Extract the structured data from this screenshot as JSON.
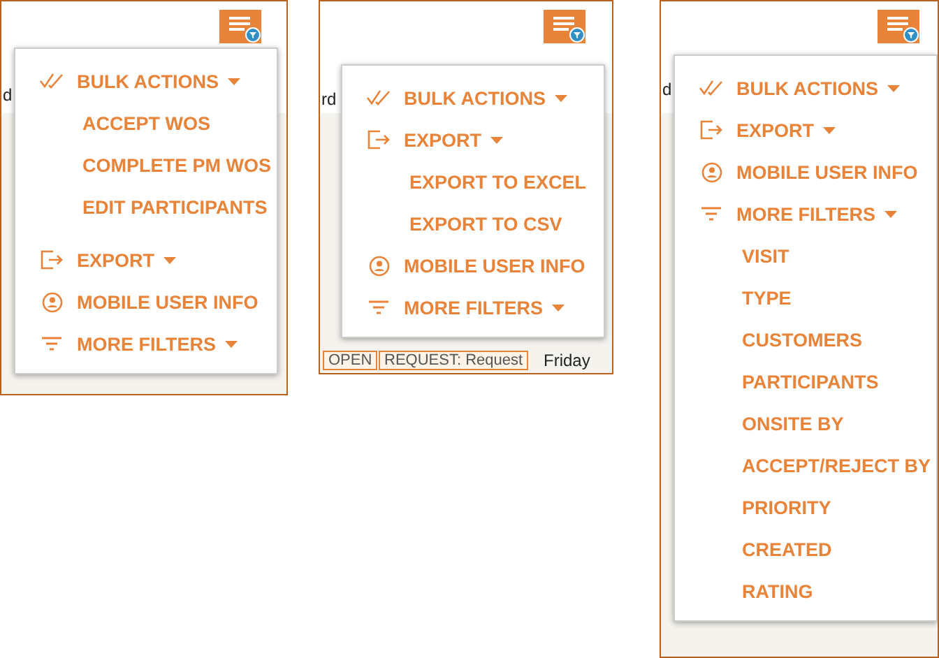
{
  "panels": [
    {
      "fragments": [
        {
          "text": "d",
          "kind": "label"
        }
      ],
      "menu": {
        "items": [
          {
            "kind": "bulk",
            "label": "BULK ACTIONS",
            "children": [
              "ACCEPT WOS",
              "COMPLETE PM WOS",
              "EDIT PARTICIPANTS"
            ]
          },
          {
            "kind": "export",
            "label": "EXPORT"
          },
          {
            "kind": "user",
            "label": "MOBILE USER INFO"
          },
          {
            "kind": "filter",
            "label": "MORE FILTERS"
          }
        ]
      }
    },
    {
      "fragments": [
        {
          "text": "rd",
          "kind": "label"
        },
        {
          "text": "OPEN",
          "kind": "cell"
        },
        {
          "text": "REQUEST: Request",
          "kind": "cell"
        },
        {
          "text": "Friday",
          "kind": "plain"
        }
      ],
      "menu": {
        "items": [
          {
            "kind": "bulk",
            "label": "BULK ACTIONS"
          },
          {
            "kind": "export",
            "label": "EXPORT",
            "children": [
              "EXPORT TO EXCEL",
              "EXPORT TO CSV"
            ]
          },
          {
            "kind": "user",
            "label": "MOBILE USER INFO"
          },
          {
            "kind": "filter",
            "label": "MORE FILTERS"
          }
        ]
      }
    },
    {
      "fragments": [
        {
          "text": "d",
          "kind": "label"
        }
      ],
      "menu": {
        "items": [
          {
            "kind": "bulk",
            "label": "BULK ACTIONS"
          },
          {
            "kind": "export",
            "label": "EXPORT"
          },
          {
            "kind": "user",
            "label": "MOBILE USER INFO"
          },
          {
            "kind": "filter",
            "label": "MORE FILTERS",
            "children": [
              "VISIT",
              "TYPE",
              "CUSTOMERS",
              "PARTICIPANTS",
              "ONSITE BY",
              "ACCEPT/REJECT BY",
              "PRIORITY",
              "CREATED",
              "RATING"
            ]
          }
        ]
      }
    }
  ]
}
